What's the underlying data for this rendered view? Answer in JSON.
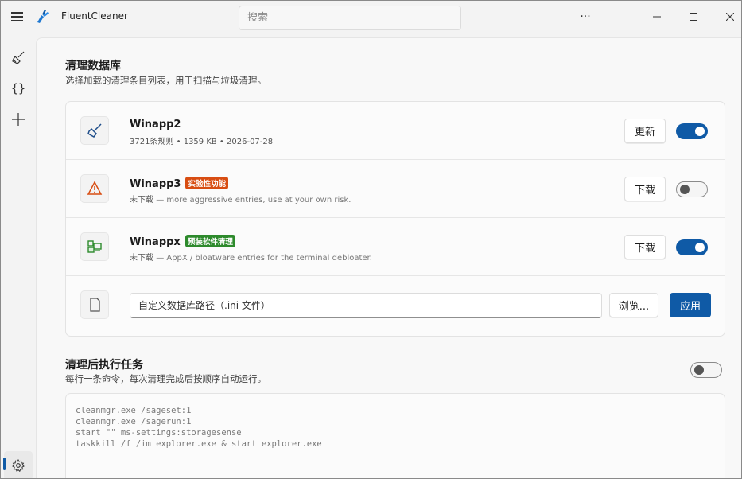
{
  "app": {
    "title": "FluentCleaner",
    "search_placeholder": "搜索",
    "more_label": "···",
    "accent_color": "#0f5aa6"
  },
  "rail": {
    "items": [
      {
        "name": "broom-icon"
      },
      {
        "name": "braces-icon",
        "label": "{}"
      },
      {
        "name": "plus-icon"
      },
      {
        "name": "gear-icon"
      }
    ]
  },
  "database": {
    "title": "清理数据库",
    "subtitle": "选择加载的清理条目列表，用于扫描与垃圾清理。",
    "rows": [
      {
        "name": "Winapp2",
        "badge": "",
        "meta": "3721条规则  •  1359 KB  •  2026-07-28",
        "description": "",
        "button": "更新",
        "enabled": true
      },
      {
        "name": "Winapp3",
        "badge": "实验性功能",
        "badge_color": "#d84d12",
        "meta": "未下载",
        "description": "—  more aggressive entries, use at your own risk.",
        "button": "下载",
        "enabled": false
      },
      {
        "name": "Winappx",
        "badge": "预装软件清理",
        "badge_color": "#2d8a2c",
        "meta": "未下载",
        "description": "—  AppX / bloatware entries for the terminal debloater.",
        "button": "下载",
        "enabled": true
      }
    ],
    "custom_path_placeholder": "自定义数据库路径（.ini 文件）",
    "browse_label": "浏览...",
    "apply_label": "应用"
  },
  "post_tasks": {
    "title": "清理后执行任务",
    "subtitle": "每行一条命令，每次清理完成后按顺序自动运行。",
    "enabled": false,
    "commands": [
      "cleanmgr.exe /sageset:1",
      "cleanmgr.exe /sagerun:1",
      "start \"\" ms-settings:storagesense",
      "taskkill /f /im explorer.exe & start explorer.exe"
    ]
  }
}
